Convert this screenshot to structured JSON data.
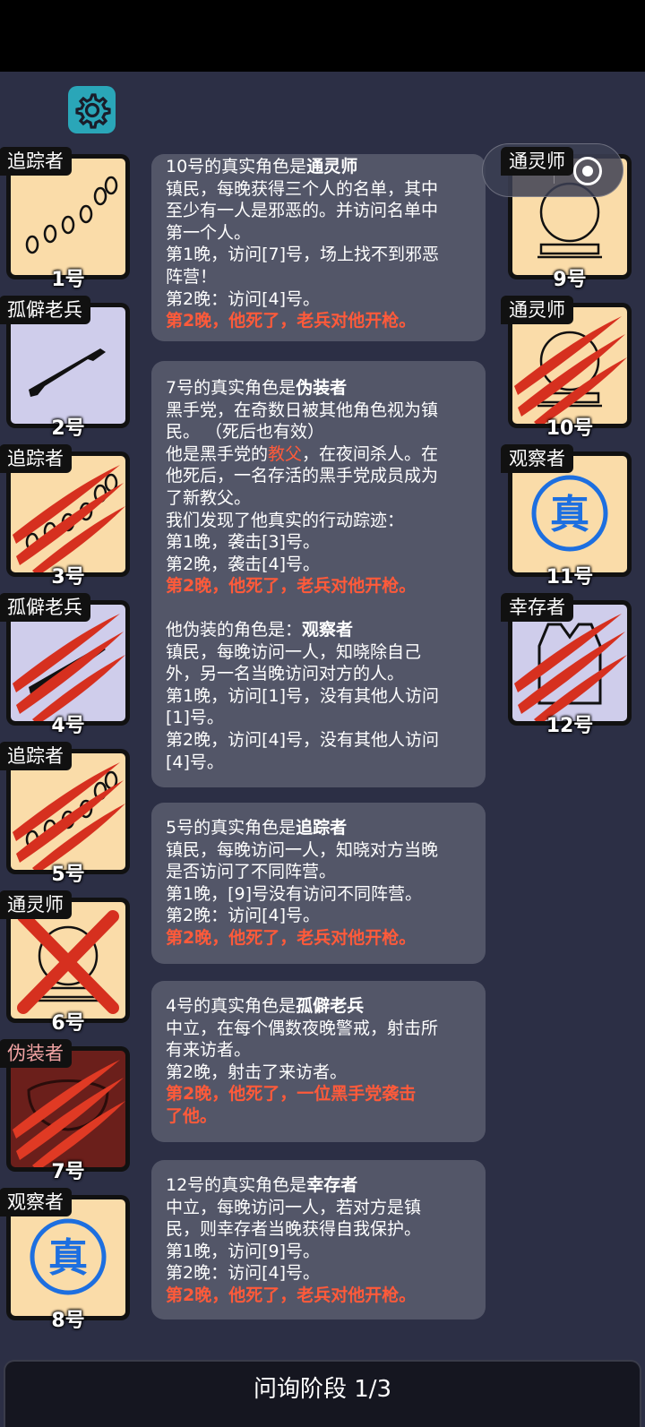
{
  "phase": "问询阶段 1/3",
  "capsule": {
    "dots": "•••"
  },
  "colors": {
    "bubble": "#535668",
    "warning": "#ff5a3a",
    "beige": "#fadca9",
    "lavender": "#cfcdeb",
    "dark_red": "#6b1f1b"
  },
  "left_cards": [
    {
      "role": "追踪者",
      "num": "1号",
      "icon": "footprints-icon",
      "bg": "beige",
      "status": "alive"
    },
    {
      "role": "孤僻老兵",
      "num": "2号",
      "icon": "rifle-icon",
      "bg": "lavender",
      "status": "alive"
    },
    {
      "role": "追踪者",
      "num": "3号",
      "icon": "footprints-icon",
      "bg": "beige",
      "status": "slashed"
    },
    {
      "role": "孤僻老兵",
      "num": "4号",
      "icon": "rifle-icon",
      "bg": "lavender",
      "status": "slashed"
    },
    {
      "role": "追踪者",
      "num": "5号",
      "icon": "footprints-icon",
      "bg": "beige",
      "status": "slashed"
    },
    {
      "role": "通灵师",
      "num": "6号",
      "icon": "crystal-ball-icon",
      "bg": "beige",
      "status": "crossed"
    },
    {
      "role": "伪装者",
      "num": "7号",
      "icon": "mask-icon",
      "bg": "dark_red",
      "status": "slashed"
    },
    {
      "role": "观察者",
      "num": "8号",
      "icon": "truth-eye-icon",
      "bg": "beige",
      "status": "alive"
    }
  ],
  "right_cards": [
    {
      "role": "通灵师",
      "num": "9号",
      "icon": "crystal-ball-icon",
      "bg": "beige",
      "status": "alive"
    },
    {
      "role": "通灵师",
      "num": "10号",
      "icon": "crystal-ball-icon",
      "bg": "beige",
      "status": "slashed"
    },
    {
      "role": "观察者",
      "num": "11号",
      "icon": "truth-eye-icon",
      "bg": "beige",
      "status": "alive"
    },
    {
      "role": "幸存者",
      "num": "12号",
      "icon": "vest-icon",
      "bg": "lavender",
      "status": "slashed"
    }
  ],
  "bubbles": [
    {
      "title_prefix": "10号的真实角色是",
      "title_role": "通灵师",
      "lines": [
        "镇民，每晚获得三个人的名单，其中",
        "至少有一人是邪恶的。并访问名单中",
        "第一个人。",
        "第1晚，访问[7]号，场上找不到邪恶",
        "阵营！",
        "第2晚：访问[4]号。"
      ],
      "warning": [
        "第2晚，他死了，老兵对他开枪。"
      ]
    },
    {
      "title_prefix": "7号的真实角色是",
      "title_role": "伪装者",
      "lines_a": [
        "黑手党，在奇数日被其他角色视为镇",
        "民。  （死后也有效）"
      ],
      "godfather_pre": "他是黑手党的",
      "godfather_word": "教父",
      "godfather_post": "，在夜间杀人。在",
      "lines_b": [
        "他死后，一名存活的黑手党成员成为",
        "了新教父。",
        "我们发现了他真实的行动踪迹：",
        "第1晚，袭击[3]号。",
        "第2晚，袭击[4]号。"
      ],
      "warning": [
        "第2晚，他死了，老兵对他开枪。"
      ],
      "disguise_prefix": "他伪装的角色是：",
      "disguise_role": "观察者",
      "lines_c": [
        "镇民，每晚访问一人，知晓除自己",
        "外，另一名当晚访问对方的人。",
        "第1晚，访问[1]号，没有其他人访问",
        "[1]号。",
        "第2晚，访问[4]号，没有其他人访问",
        "[4]号。"
      ]
    },
    {
      "title_prefix": "5号的真实角色是",
      "title_role": "追踪者",
      "lines": [
        "镇民，每晚访问一人，知晓对方当晚",
        "是否访问了不同阵营。",
        "第1晚，[9]号没有访问不同阵营。",
        "第2晚：访问[4]号。"
      ],
      "warning": [
        "第2晚，他死了，老兵对他开枪。"
      ]
    },
    {
      "title_prefix": "4号的真实角色是",
      "title_role": "孤僻老兵",
      "lines": [
        "中立，在每个偶数夜晚警戒，射击所",
        "有来访者。",
        "第2晚，射击了来访者。"
      ],
      "warning": [
        "第2晚，他死了，一位黑手党袭击",
        "了他。"
      ]
    },
    {
      "title_prefix": "12号的真实角色是",
      "title_role": "幸存者",
      "lines": [
        "中立，每晚访问一人，若对方是镇",
        "民，则幸存者当晚获得自我保护。",
        "第1晚，访问[9]号。",
        "第2晚：访问[4]号。"
      ],
      "warning": [
        "第2晚，他死了，老兵对他开枪。"
      ]
    }
  ]
}
